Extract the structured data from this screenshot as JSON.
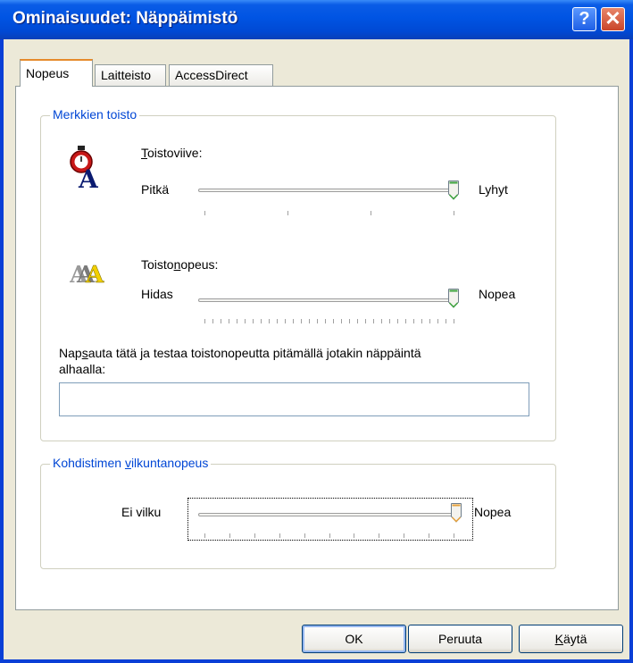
{
  "window": {
    "title": "Ominaisuudet: Näppäimistö",
    "help": "?",
    "close": "✕"
  },
  "tabs": [
    "Nopeus",
    "Laitteisto",
    "AccessDirect"
  ],
  "repeat_group": {
    "label": "Merkkien toisto",
    "delay": {
      "label_u": "T",
      "label_rest": "oistoviive:",
      "left": "Pitkä",
      "right": "Lyhyt",
      "value_fraction": 1.0
    },
    "rate": {
      "label_a": "Toisto",
      "label_u": "n",
      "label_b": "opeus:",
      "left": "Hidas",
      "right": "Nopea",
      "value_fraction": 1.0
    },
    "test_prompt_a": "Nap",
    "test_prompt_u": "s",
    "test_prompt_b": "auta tätä ja testaa toistonopeutta pitämällä jotakin näppäintä",
    "test_prompt_line2": "alhaalla:",
    "test_value": ""
  },
  "cursor_group": {
    "label_a": "Kohdistimen ",
    "label_u": "v",
    "label_b": "ilkuntanopeus",
    "left": "Ei vilku",
    "right": "Nopea",
    "value_fraction": 0.96
  },
  "buttons": {
    "ok": "OK",
    "cancel": "Peruuta",
    "apply_u": "K",
    "apply_rest": "äytä"
  }
}
